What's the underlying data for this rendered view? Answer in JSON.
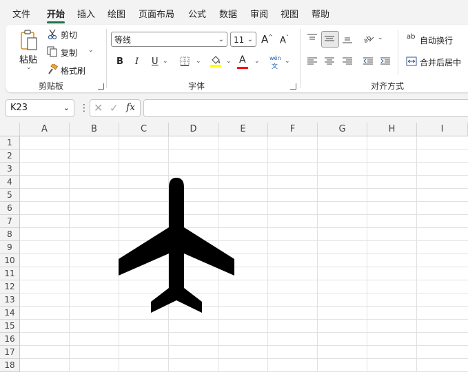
{
  "menu": {
    "tabs": [
      "文件",
      "开始",
      "插入",
      "绘图",
      "页面布局",
      "公式",
      "数据",
      "审阅",
      "视图",
      "帮助"
    ],
    "active": "开始"
  },
  "clipboard": {
    "paste": "粘贴",
    "cut": "剪切",
    "copy": "复制",
    "format_painter": "格式刷",
    "group_label": "剪贴板"
  },
  "font": {
    "name": "等线",
    "size": "11",
    "grow": "A",
    "shrink": "A",
    "bold": "B",
    "italic": "I",
    "underline": "U",
    "font_color_letter": "A",
    "phonetic_top": "wén",
    "phonetic_bottom": "文",
    "group_label": "字体",
    "fill_color": "#ffff00",
    "font_color": "#ff0000"
  },
  "alignment": {
    "wrap_text": "自动换行",
    "merge_center": "合并后居中",
    "group_label": "对齐方式",
    "wrap_glyph": "ab"
  },
  "formula_bar": {
    "name_box": "K23",
    "fx": "fx",
    "formula": ""
  },
  "sheet": {
    "columns": [
      "A",
      "B",
      "C",
      "D",
      "E",
      "F",
      "G",
      "H",
      "I"
    ],
    "rows": [
      "1",
      "2",
      "3",
      "4",
      "5",
      "6",
      "7",
      "8",
      "9",
      "10",
      "11",
      "12",
      "13",
      "14",
      "15",
      "16",
      "17",
      "18"
    ],
    "shape_icon": "airplane-icon"
  }
}
